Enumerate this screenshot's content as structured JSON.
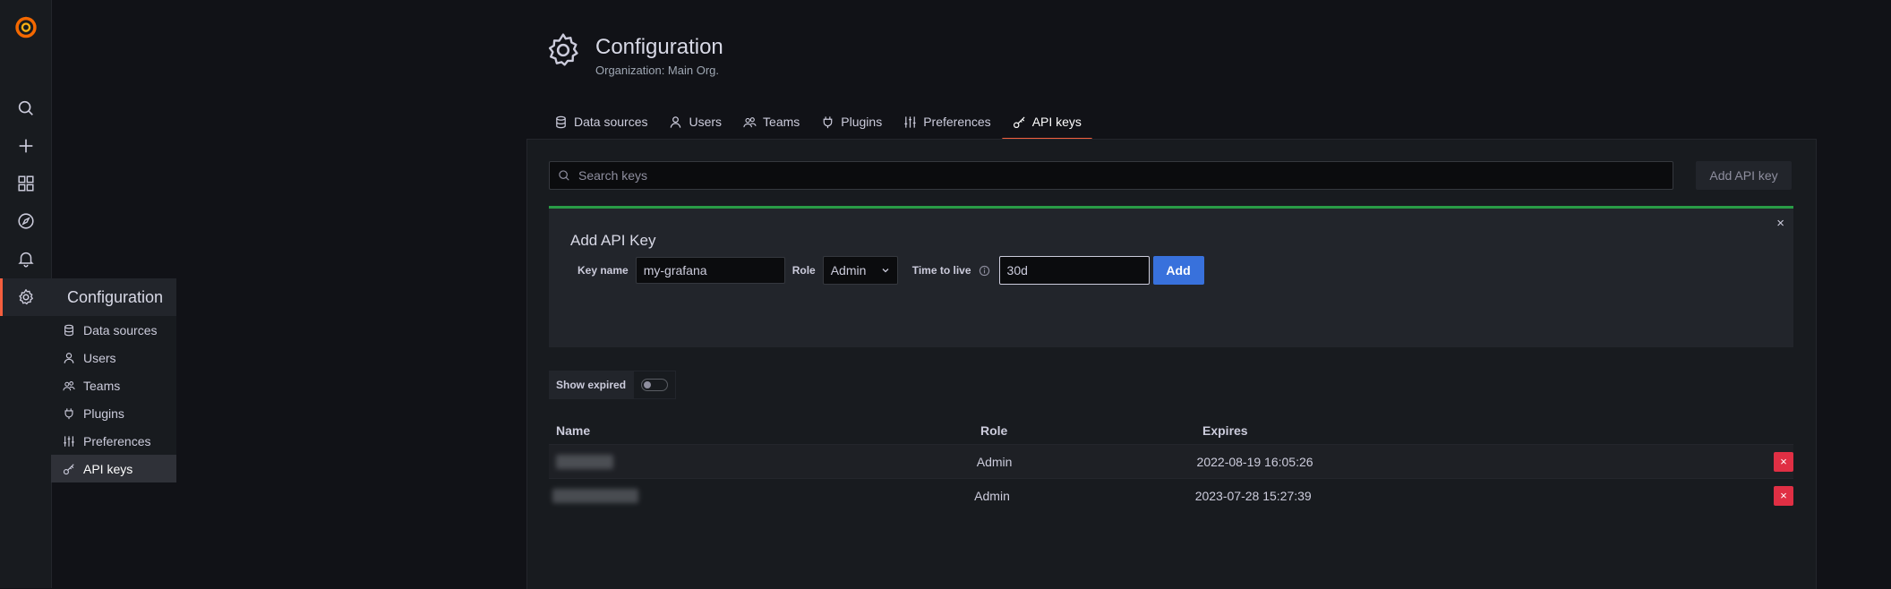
{
  "sidebar": {
    "icons": [
      "grafana-logo-icon",
      "search-icon",
      "plus-icon",
      "dashboards-icon",
      "compass-icon",
      "bell-icon",
      "gear-icon"
    ],
    "flyout": {
      "title": "Configuration",
      "items": [
        {
          "label": "Data sources",
          "icon": "database-icon"
        },
        {
          "label": "Users",
          "icon": "user-icon"
        },
        {
          "label": "Teams",
          "icon": "users-icon"
        },
        {
          "label": "Plugins",
          "icon": "plug-icon"
        },
        {
          "label": "Preferences",
          "icon": "sliders-icon"
        },
        {
          "label": "API keys",
          "icon": "key-icon",
          "active": true
        }
      ]
    }
  },
  "header": {
    "title": "Configuration",
    "subtitle": "Organization: Main Org."
  },
  "tabs": [
    {
      "label": "Data sources",
      "icon": "database-icon"
    },
    {
      "label": "Users",
      "icon": "user-icon"
    },
    {
      "label": "Teams",
      "icon": "users-icon"
    },
    {
      "label": "Plugins",
      "icon": "plug-icon"
    },
    {
      "label": "Preferences",
      "icon": "sliders-icon"
    },
    {
      "label": "API keys",
      "icon": "key-icon",
      "active": true
    }
  ],
  "search": {
    "placeholder": "Search keys"
  },
  "add_api_key_button": "Add API key",
  "add_panel": {
    "title": "Add API Key",
    "close": "×",
    "key_name_label": "Key name",
    "key_name_value": "my-grafana",
    "role_label": "Role",
    "role_value": "Admin",
    "ttl_label": "Time to live",
    "ttl_value": "30d",
    "submit": "Add"
  },
  "show_expired_label": "Show expired",
  "table": {
    "headers": [
      "Name",
      "Role",
      "Expires"
    ],
    "rows": [
      {
        "name": "",
        "role": "Admin",
        "expires": "2022-08-19 16:05:26"
      },
      {
        "name": "",
        "role": "Admin",
        "expires": "2023-07-28 15:27:39"
      }
    ]
  },
  "delete_glyph": "×",
  "colors": {
    "accent": "#f55f3e",
    "primary_button": "#3871dc",
    "danger_button": "#e02f44",
    "success_bar": "#299c46"
  }
}
